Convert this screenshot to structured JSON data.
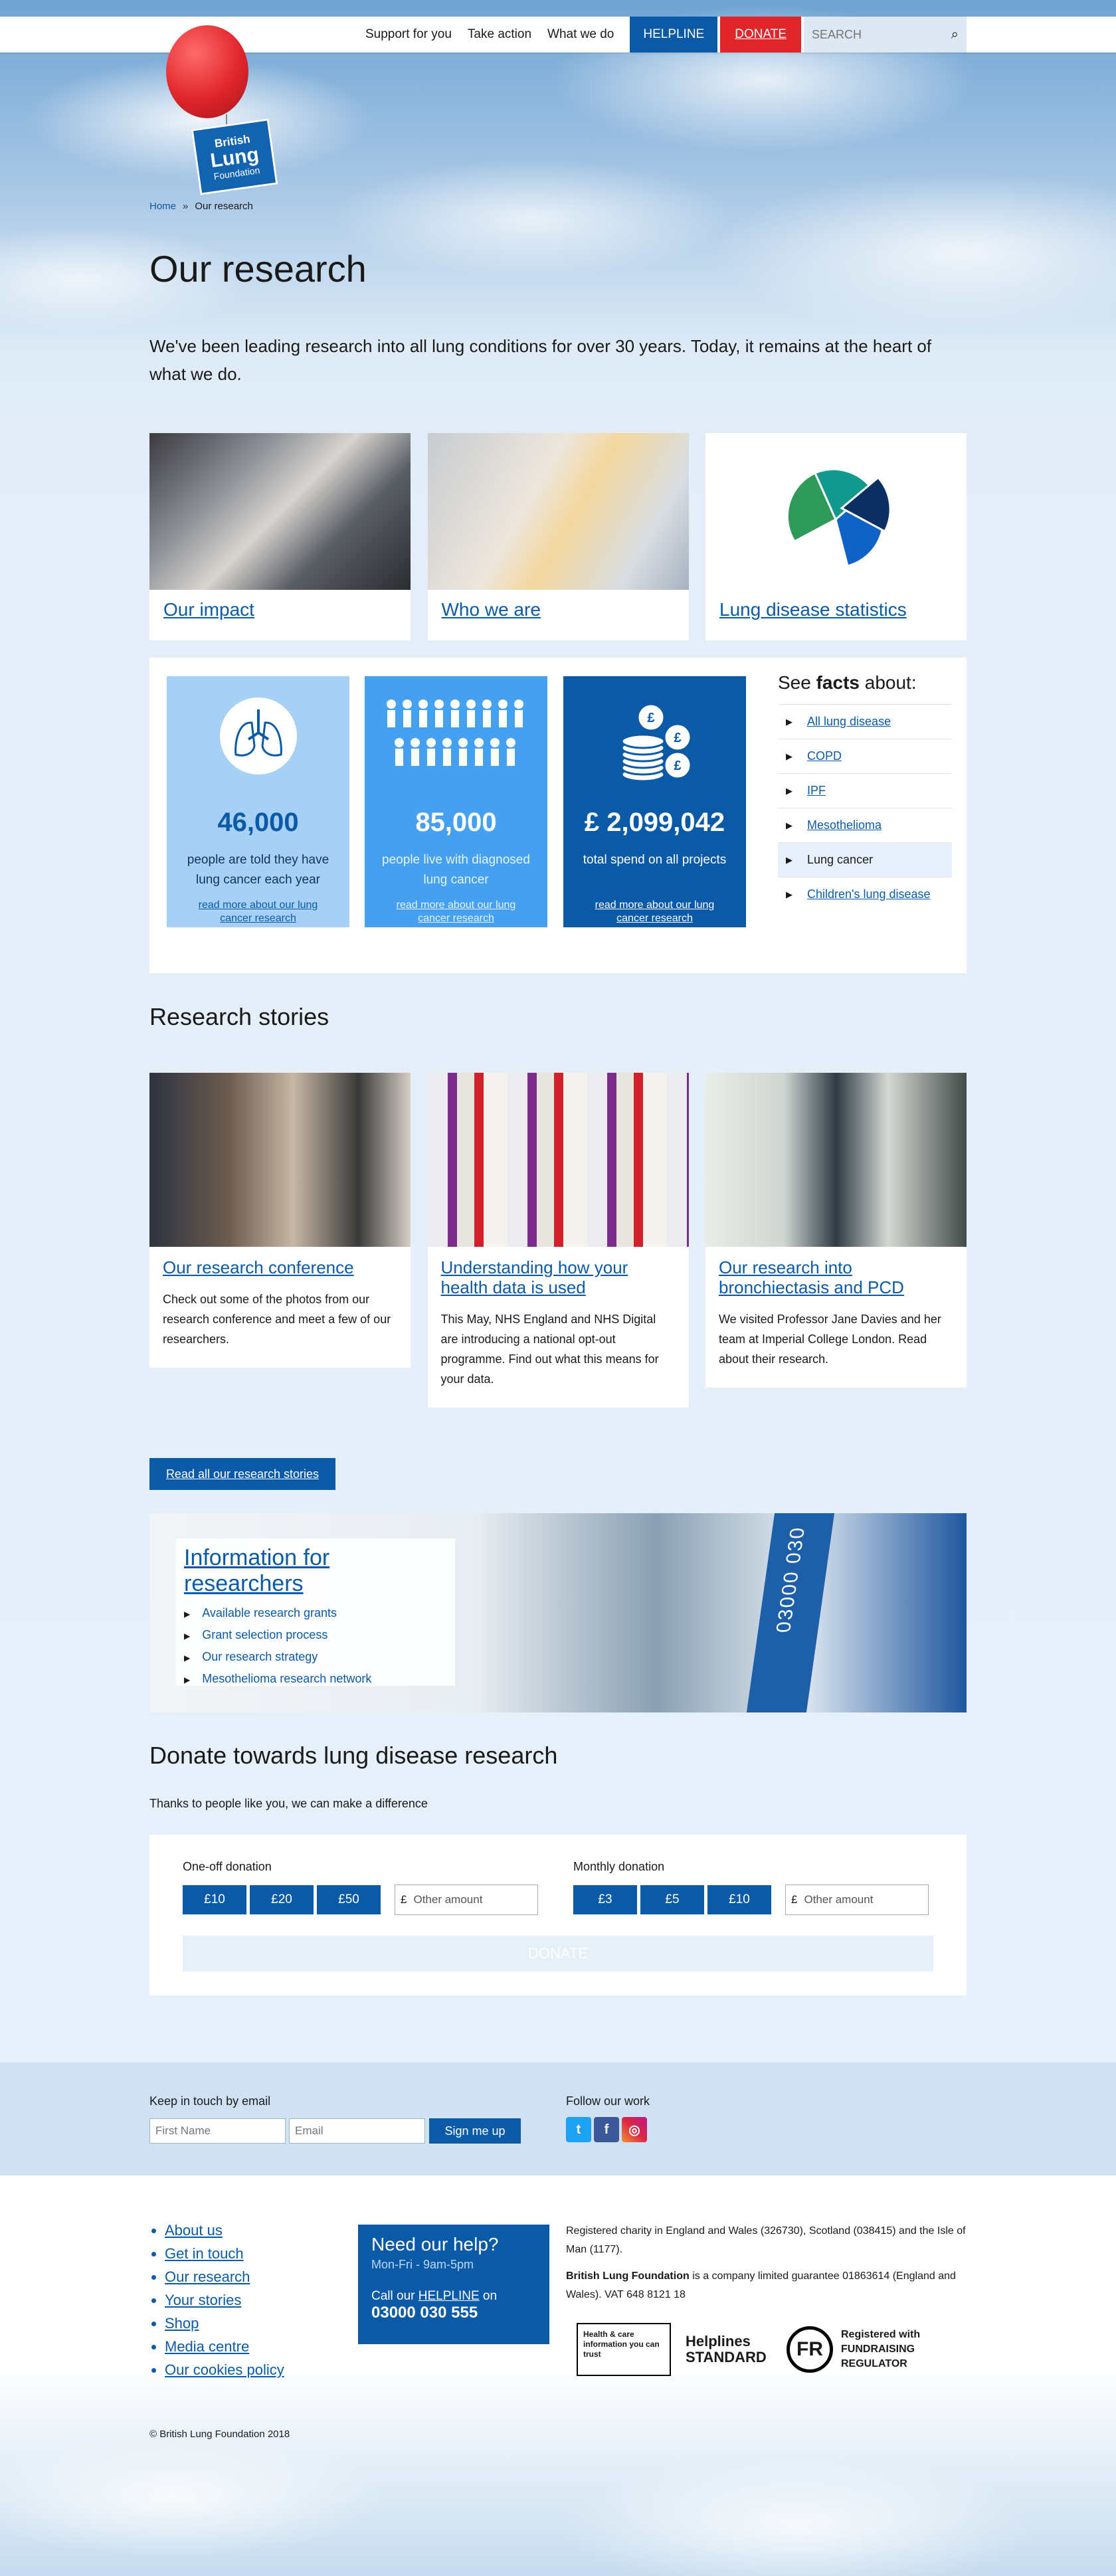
{
  "nav": {
    "links": [
      "Support for you",
      "Take action",
      "What we do"
    ],
    "helpline": "HELPLINE",
    "donate": "DONATE",
    "search_placeholder": "SEARCH"
  },
  "logo": {
    "line1": "British",
    "line2": "Lung",
    "line3": "Foundation"
  },
  "breadcrumb": {
    "home": "Home",
    "sep": "»",
    "current": "Our research"
  },
  "page": {
    "title": "Our research",
    "intro": "We've been leading research into all lung conditions for over 30 years. Today, it remains at the heart of what we do."
  },
  "top_cards": [
    {
      "label": "Our impact"
    },
    {
      "label": "Who we are"
    },
    {
      "label": "Lung disease statistics"
    }
  ],
  "pie_colors": [
    "#2e9a5a",
    "#11998e",
    "#0f63c6",
    "#0b2f62"
  ],
  "facts": [
    {
      "number": "46,000",
      "desc": "people are told they have lung cancer each year",
      "more": "read more about our lung cancer research",
      "icon": "lungs-icon"
    },
    {
      "number": "85,000",
      "desc": "people live with diagnosed lung cancer",
      "more": "read more about our lung cancer research",
      "icon": "people-icon"
    },
    {
      "number": "£ 2,099,042",
      "desc": "total spend on all projects",
      "more": "read more about our lung cancer research",
      "icon": "coins-icon"
    }
  ],
  "facts_side": {
    "heading_pre": "See",
    "heading_bold": "facts",
    "heading_post": "about:",
    "items": [
      "All lung disease",
      "COPD",
      "IPF",
      "Mesothelioma",
      "Lung cancer",
      "Children's lung disease"
    ],
    "active": "Lung cancer"
  },
  "stories": {
    "title": "Research stories",
    "items": [
      {
        "title": "Our research conference",
        "text": "Check out some of the photos from our research conference and meet a few of our researchers."
      },
      {
        "title": "Understanding how your health data is used",
        "text": "This May, NHS England and NHS Digital are introducing a national opt-out programme. Find out what this means for your data."
      },
      {
        "title": "Our research into bronchiectasis and PCD",
        "text": "We visited Professor Jane Davies and her team at Imperial College London. Read about their research."
      }
    ],
    "read_all": "Read all our research stories"
  },
  "info": {
    "title": "Information for researchers",
    "items": [
      "Available research grants",
      "Grant selection process",
      "Our research strategy",
      "Mesothelioma research network"
    ],
    "lanyard_text": "03000 030"
  },
  "donate": {
    "title": "Donate towards lung disease research",
    "subtitle": "Thanks to people like you, we can make a difference",
    "one_off_label": "One-off donation",
    "one_off_amounts": [
      "£10",
      "£20",
      "£50"
    ],
    "monthly_label": "Monthly donation",
    "monthly_amounts": [
      "£3",
      "£5",
      "£10"
    ],
    "currency": "£",
    "other_placeholder": "Other amount",
    "button": "DONATE"
  },
  "keep_in_touch": {
    "label": "Keep in touch by email",
    "first_name_placeholder": "First Name",
    "email_placeholder": "Email",
    "signup": "Sign me up",
    "follow_label": "Follow our work"
  },
  "footer": {
    "links": [
      "About us",
      "Get in touch",
      "Our research",
      "Your stories",
      "Shop",
      "Media centre",
      "Our cookies policy"
    ],
    "help_title": "Need our help?",
    "help_hours": "Mon-Fri - 9am-5pm",
    "help_call_pre": "Call our",
    "help_call_link": "HELPLINE",
    "help_call_post": "on",
    "help_phone": "03000 030 555",
    "charity": "Registered charity in England and Wales (326730), Scotland (038415) and the Isle of Man (1177).",
    "company_bold": "British Lung Foundation",
    "company_rest": " is a company limited guarantee 01863614 (England and Wales). VAT 648 8121 18",
    "badges": [
      "Health & care information you can trust",
      "Helplines STANDARD",
      "Registered with FUNDRAISING REGULATOR"
    ],
    "copyright": "© British Lung Foundation 2018"
  }
}
